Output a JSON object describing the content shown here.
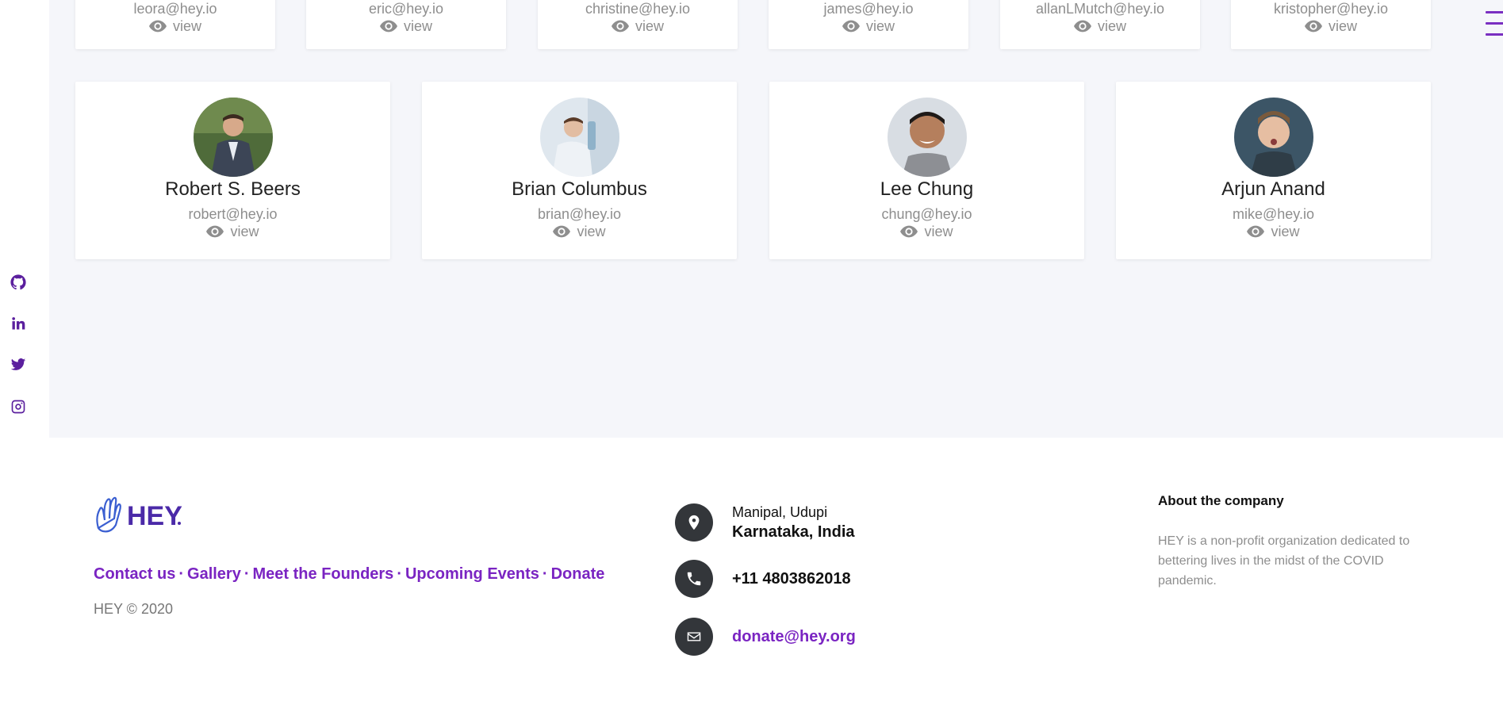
{
  "top_row_cards": [
    {
      "email": "leora@hey.io",
      "view": "view"
    },
    {
      "email": "eric@hey.io",
      "view": "view"
    },
    {
      "email": "christine@hey.io",
      "view": "view"
    },
    {
      "email": "james@hey.io",
      "view": "view"
    },
    {
      "email": "allanLMutch@hey.io",
      "view": "view"
    },
    {
      "email": "kristopher@hey.io",
      "view": "view"
    }
  ],
  "members": [
    {
      "name": "Robert S. Beers",
      "email": "robert@hey.io",
      "view": "view"
    },
    {
      "name": "Brian Columbus",
      "email": "brian@hey.io",
      "view": "view"
    },
    {
      "name": "Lee Chung",
      "email": "chung@hey.io",
      "view": "view"
    },
    {
      "name": "Arjun Anand",
      "email": "mike@hey.io",
      "view": "view"
    }
  ],
  "social_icons": [
    "github-icon",
    "linkedin-icon",
    "twitter-icon",
    "instagram-icon"
  ],
  "footer": {
    "logo_text": "HEY",
    "links": [
      "Contact us",
      "Gallery",
      "Meet the Founders",
      "Upcoming Events",
      "Donate"
    ],
    "separator": "·",
    "copyright": "HEY © 2020",
    "address_line1": "Manipal, Udupi",
    "address_line2": "Karnataka, India",
    "phone": "+11 4803862018",
    "email": "donate@hey.org",
    "about_title": "About the company",
    "about_text": "HEY is a non-profit organization dedicated to bettering lives in the midst of the COVID pandemic."
  },
  "colors": {
    "accent": "#7a24c2",
    "background": "#f5f6fa",
    "icon_circle": "#33363a"
  }
}
